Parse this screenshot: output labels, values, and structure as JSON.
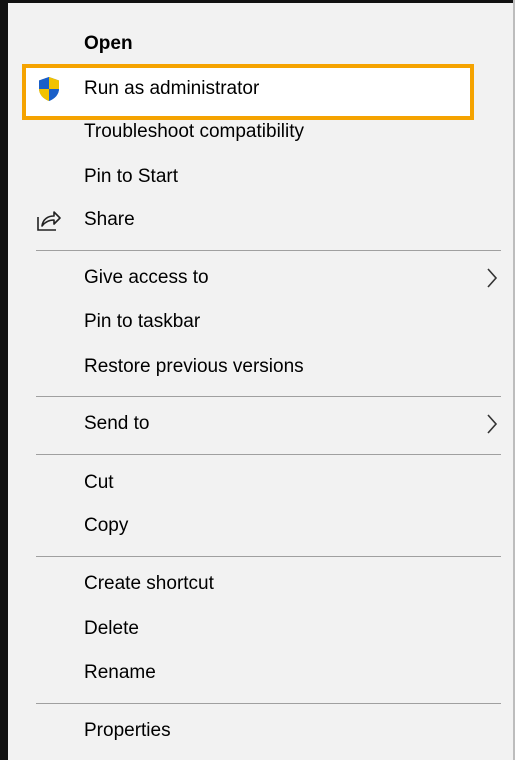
{
  "menu": {
    "items": [
      {
        "label": "Open",
        "bold": true
      },
      {
        "label": "Run as administrator",
        "icon": "uac-shield-icon"
      },
      {
        "label": "Troubleshoot compatibility"
      },
      {
        "label": "Pin to Start"
      },
      {
        "label": "Share",
        "icon": "share-icon"
      },
      {
        "label": "Give access to",
        "submenu": true
      },
      {
        "label": "Pin to taskbar"
      },
      {
        "label": "Restore previous versions"
      },
      {
        "label": "Send to",
        "submenu": true
      },
      {
        "label": "Cut"
      },
      {
        "label": "Copy"
      },
      {
        "label": "Create shortcut"
      },
      {
        "label": "Delete"
      },
      {
        "label": "Rename"
      },
      {
        "label": "Properties"
      }
    ]
  },
  "colors": {
    "highlight_border": "#f5a300",
    "menu_background": "#f2f2f2",
    "separator": "#a0a0a0"
  }
}
